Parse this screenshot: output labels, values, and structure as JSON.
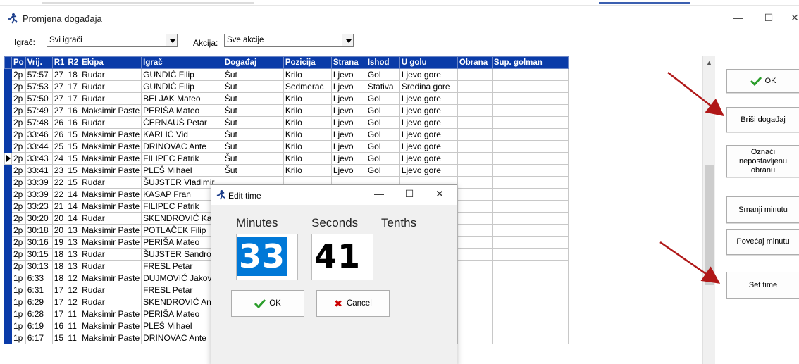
{
  "window": {
    "title": "Promjena događaja",
    "minimize": "—",
    "maximize": "☐",
    "close": "✕"
  },
  "filters": {
    "player_label": "Igrač:",
    "player_value": "Svi igrači",
    "action_label": "Akcija:",
    "action_value": "Sve akcije"
  },
  "table": {
    "columns": [
      "Po",
      "Vrij.",
      "R1",
      "R2",
      "Ekipa",
      "Igrač",
      "Događaj",
      "Pozicija",
      "Strana",
      "Ishod",
      "U golu",
      "Obrana",
      "Sup. golman"
    ],
    "current_row": 7,
    "rows": [
      [
        "2p",
        "57:57",
        "27",
        "18",
        "Rudar",
        "GUNDIĆ Filip",
        "Šut",
        "Krilo",
        "Ljevo",
        "Gol",
        "Ljevo gore",
        "",
        ""
      ],
      [
        "2p",
        "57:53",
        "27",
        "17",
        "Rudar",
        "GUNDIĆ Filip",
        "Šut",
        "Sedmerac",
        "Ljevo",
        "Stativa",
        "Sredina gore",
        "",
        ""
      ],
      [
        "2p",
        "57:50",
        "27",
        "17",
        "Rudar",
        "BELJAK Mateo",
        "Šut",
        "Krilo",
        "Ljevo",
        "Gol",
        "Ljevo gore",
        "",
        ""
      ],
      [
        "2p",
        "57:49",
        "27",
        "16",
        "Maksimir Paste",
        "PERIŠA Mateo",
        "Šut",
        "Krilo",
        "Ljevo",
        "Gol",
        "Ljevo gore",
        "",
        ""
      ],
      [
        "2p",
        "57:48",
        "26",
        "16",
        "Rudar",
        "ČERNAUŠ Petar",
        "Šut",
        "Krilo",
        "Ljevo",
        "Gol",
        "Ljevo gore",
        "",
        ""
      ],
      [
        "2p",
        "33:46",
        "26",
        "15",
        "Maksimir Paste",
        "KARLIĆ Vid",
        "Šut",
        "Krilo",
        "Ljevo",
        "Gol",
        "Ljevo gore",
        "",
        ""
      ],
      [
        "2p",
        "33:44",
        "25",
        "15",
        "Maksimir Paste",
        "DRINOVAC Ante",
        "Šut",
        "Krilo",
        "Ljevo",
        "Gol",
        "Ljevo gore",
        "",
        ""
      ],
      [
        "2p",
        "33:43",
        "24",
        "15",
        "Maksimir Paste",
        "FILIPEC Patrik",
        "Šut",
        "Krilo",
        "Ljevo",
        "Gol",
        "Ljevo gore",
        "",
        ""
      ],
      [
        "2p",
        "33:41",
        "23",
        "15",
        "Maksimir Paste",
        "PLEŠ Mihael",
        "Šut",
        "Krilo",
        "Ljevo",
        "Gol",
        "Ljevo gore",
        "",
        ""
      ],
      [
        "2p",
        "33:39",
        "22",
        "15",
        "Rudar",
        "ŠUJSTER Vladimir",
        "",
        "",
        "",
        "",
        "",
        "",
        ""
      ],
      [
        "2p",
        "33:39",
        "22",
        "14",
        "Maksimir Paste",
        "KASAP Fran",
        "",
        "",
        "",
        "",
        "",
        "",
        ""
      ],
      [
        "2p",
        "33:23",
        "21",
        "14",
        "Maksimir Paste",
        "FILIPEC Patrik",
        "",
        "",
        "",
        "",
        "",
        "",
        ""
      ],
      [
        "2p",
        "30:20",
        "20",
        "14",
        "Rudar",
        "SKENDROVIĆ Karlo",
        "",
        "",
        "",
        "",
        "",
        "",
        ""
      ],
      [
        "2p",
        "30:18",
        "20",
        "13",
        "Maksimir Paste",
        "POTLAČEK Filip",
        "",
        "",
        "",
        "",
        "",
        "",
        ""
      ],
      [
        "2p",
        "30:16",
        "19",
        "13",
        "Maksimir Paste",
        "PERIŠA Mateo",
        "",
        "",
        "",
        "",
        "",
        "",
        ""
      ],
      [
        "2p",
        "30:15",
        "18",
        "13",
        "Rudar",
        "ŠUJSTER Sandro",
        "",
        "",
        "",
        "",
        "",
        "",
        ""
      ],
      [
        "2p",
        "30:13",
        "18",
        "13",
        "Rudar",
        "FRESL Petar",
        "",
        "",
        "",
        "",
        "",
        "",
        ""
      ],
      [
        "1p",
        "6:33",
        "18",
        "12",
        "Maksimir Paste",
        "DUJMOVIĆ Jakov",
        "",
        "",
        "",
        "",
        "",
        "",
        ""
      ],
      [
        "1p",
        "6:31",
        "17",
        "12",
        "Rudar",
        "FRESL Petar",
        "",
        "",
        "",
        "",
        "",
        "",
        ""
      ],
      [
        "1p",
        "6:29",
        "17",
        "12",
        "Rudar",
        "SKENDROVIĆ Antor",
        "",
        "",
        "",
        "",
        "",
        "",
        ""
      ],
      [
        "1p",
        "6:28",
        "17",
        "11",
        "Maksimir Paste",
        "PERIŠA Mateo",
        "",
        "",
        "",
        "",
        "",
        "",
        ""
      ],
      [
        "1p",
        "6:19",
        "16",
        "11",
        "Maksimir Paste",
        "PLEŠ Mihael",
        "",
        "",
        "",
        "",
        "",
        "",
        ""
      ],
      [
        "1p",
        "6:17",
        "15",
        "11",
        "Maksimir Paste",
        "DRINOVAC Ante",
        "",
        "",
        "",
        "",
        "",
        "",
        ""
      ]
    ]
  },
  "sidebar": {
    "ok": "OK",
    "delete_event": "Briši događaj",
    "mark_unset_defense": "Označi nepostavljenu obranu",
    "decrease_minute": "Smanji minutu",
    "increase_minute": "Povećaj minutu",
    "set_time": "Set time"
  },
  "dialog": {
    "title": "Edit time",
    "minutes_label": "Minutes",
    "seconds_label": "Seconds",
    "tenths_label": "Tenths",
    "minutes_value": "33",
    "seconds_value": "41",
    "ok": "OK",
    "cancel": "Cancel"
  },
  "colors": {
    "header_blue": "#0a3ba8",
    "selection_blue": "#0078d7",
    "ok_green": "#2a9d2a",
    "cancel_red": "#cc0000",
    "arrow_red": "#b01818"
  }
}
